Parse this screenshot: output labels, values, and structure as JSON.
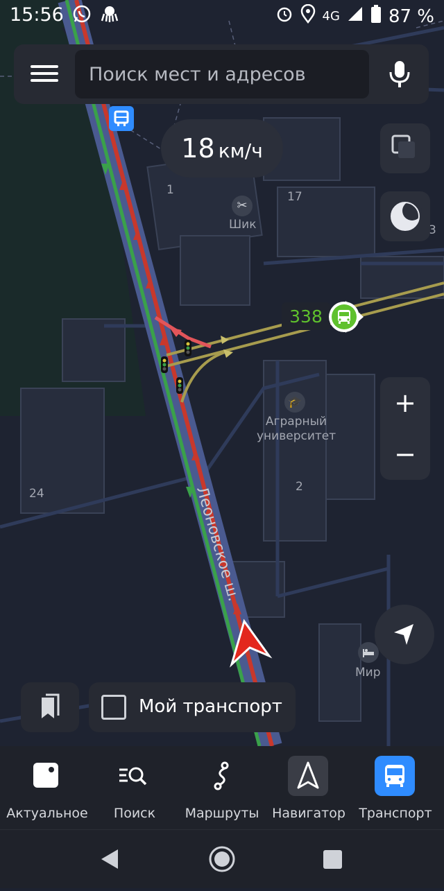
{
  "status_bar": {
    "time": "15:56",
    "network": "4G",
    "battery": "87 %",
    "icons": [
      "whatsapp-icon",
      "octopus-icon",
      "alarm-icon",
      "location-icon",
      "signal-icon",
      "battery-icon"
    ]
  },
  "search": {
    "placeholder": "Поиск мест и адресов"
  },
  "speed": {
    "value": "18",
    "unit": "км/ч"
  },
  "map_labels": {
    "building_1": "1",
    "building_17": "17",
    "building_3": "3",
    "building_2": "2",
    "building_24": "24",
    "poi_shik": "Шик",
    "poi_agrarian_line1": "Аграрный",
    "poi_agrarian_line2": "университет",
    "poi_mir": "Мир",
    "street": "Леоновское ш."
  },
  "bus": {
    "route_number": "338",
    "color": "#5fc12d"
  },
  "zoom": {
    "plus": "+",
    "minus": "−"
  },
  "my_transport": {
    "label": "Мой транспорт",
    "checked": false
  },
  "bottom_nav": [
    {
      "label": "Актуальное",
      "icon": "actual-icon",
      "active": false
    },
    {
      "label": "Поиск",
      "icon": "search-list-icon",
      "active": false
    },
    {
      "label": "Маршруты",
      "icon": "routes-icon",
      "active": false
    },
    {
      "label": "Навигатор",
      "icon": "navigator-icon",
      "active": false
    },
    {
      "label": "Транспорт",
      "icon": "bus-icon",
      "active": true
    }
  ],
  "colors": {
    "accent_blue": "#2f8cff",
    "traffic_red": "#c8382c",
    "traffic_green": "#3aa14a",
    "route_yellow": "#a79c4e",
    "position_arrow": "#e3271d"
  }
}
